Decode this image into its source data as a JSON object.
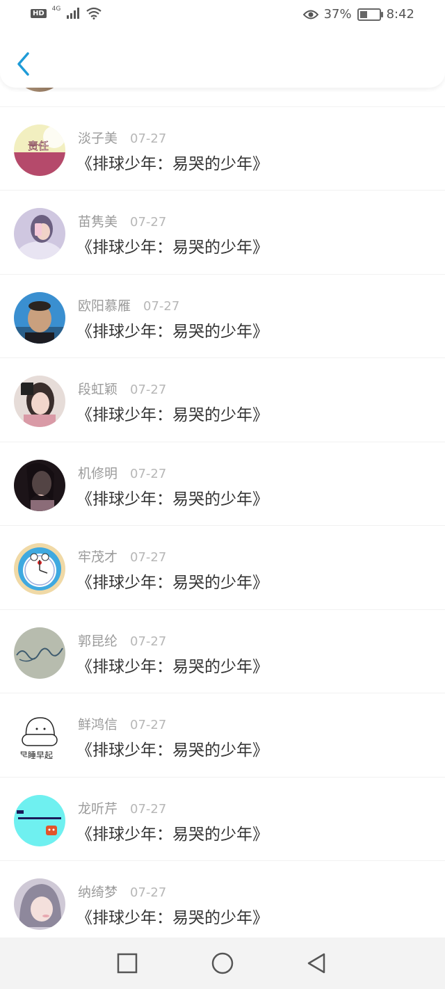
{
  "status_bar": {
    "hd": "HD",
    "network": "4G",
    "battery_percent": "37%",
    "battery_level": 0.37,
    "time": "8:42",
    "icons": [
      "signal-icon",
      "wifi-icon",
      "eye-icon",
      "battery-icon"
    ]
  },
  "header": {
    "back_icon": "chevron-left-icon",
    "accent_color": "#1e9bd7"
  },
  "comments": [
    {
      "name": "淡子美",
      "date": "07-27",
      "text": "《排球少年：易哭的少年》",
      "avatar_text": "责任"
    },
    {
      "name": "苗隽美",
      "date": "07-27",
      "text": "《排球少年：易哭的少年》"
    },
    {
      "name": "欧阳慕雁",
      "date": "07-27",
      "text": "《排球少年：易哭的少年》"
    },
    {
      "name": "段虹颖",
      "date": "07-27",
      "text": "《排球少年：易哭的少年》"
    },
    {
      "name": "机修明",
      "date": "07-27",
      "text": "《排球少年：易哭的少年》"
    },
    {
      "name": "牢茂才",
      "date": "07-27",
      "text": "《排球少年：易哭的少年》"
    },
    {
      "name": "郭昆纶",
      "date": "07-27",
      "text": "《排球少年：易哭的少年》"
    },
    {
      "name": "鲜鸿信",
      "date": "07-27",
      "text": "《排球少年：易哭的少年》",
      "avatar_text": "早睡早起"
    },
    {
      "name": "龙听芹",
      "date": "07-27",
      "text": "《排球少年：易哭的少年》"
    },
    {
      "name": "纳绮梦",
      "date": "07-27",
      "text": "《排球少年：易哭的少年》"
    }
  ],
  "nav_bar": {
    "buttons": [
      "square-recents-icon",
      "circle-home-icon",
      "triangle-back-icon"
    ]
  }
}
